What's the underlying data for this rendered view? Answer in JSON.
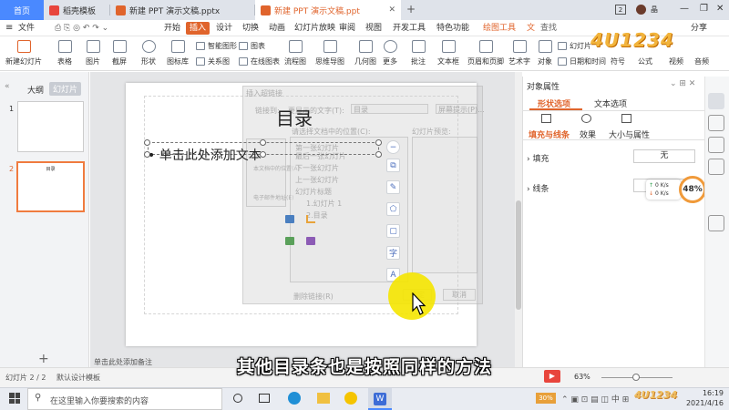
{
  "tabs": [
    {
      "label": "首页"
    },
    {
      "label": "稻壳模板"
    },
    {
      "label": "新建 PPT 演示文稿.pptx"
    },
    {
      "label": "新建 PPT 演示文稿.ppt"
    }
  ],
  "tabbar_right": {
    "badge": "2",
    "user": "晶"
  },
  "menu": {
    "file": "文件",
    "items": [
      "开始",
      "插入",
      "设计",
      "切换",
      "动画",
      "幻灯片放映",
      "审阅",
      "视图",
      "开发工具",
      "特色功能",
      "绘图工具",
      "文"
    ],
    "active": "插入",
    "search": "查找",
    "right": [
      "分享"
    ]
  },
  "ribbon": {
    "big": [
      "新建幻灯片",
      "表格",
      "图片",
      "截屏",
      "形状",
      "图标库",
      "关系图",
      "流程图",
      "思维导图",
      "几何图",
      "更多",
      "批注",
      "文本框",
      "页眉和页脚",
      "艺术字",
      "对象"
    ],
    "small": [
      "智能图形",
      "图表",
      "在线图表",
      "幻灯片",
      "日期和时间"
    ],
    "right_partial": [
      "符号",
      "公式",
      "视频",
      "音频"
    ]
  },
  "left_panel": {
    "tab_outline": "大纲",
    "tab_slides": "幻灯片",
    "slides": [
      {
        "num": "1"
      },
      {
        "num": "2",
        "title": "目录"
      }
    ],
    "add": "+"
  },
  "slide": {
    "title": "目录",
    "placeholder": "单击此处添加文本"
  },
  "ghost_dialog": {
    "title": "插入超链接",
    "link_to_label": "链接到:",
    "display_text_label": "要显示的文字(T):",
    "display_text_value": "目录",
    "tooltip": "屏幕提示(P)...",
    "select_position": "请选择文档中的位置(C):",
    "preview": "幻灯片预览:",
    "items": [
      "第一张幻灯片",
      "最后一张幻灯片",
      "下一张幻灯片",
      "上一张幻灯片",
      "幻灯片标题",
      "1.幻灯片 1",
      "2.目录"
    ],
    "left_items": [
      "原有文件或网页(X)",
      "本文档中的位置(A)",
      "电子邮件地址(E)",
      "链接附件"
    ],
    "remove_link": "删除链接(R)",
    "ok": "确定",
    "cancel": "取消"
  },
  "float_toolbar": [
    "−",
    "⧉",
    "✎",
    "⬠",
    "▢",
    "字",
    "A"
  ],
  "right_panel": {
    "header": "对象属性",
    "tab_shape": "形状选项",
    "tab_text": "文本选项",
    "sub_fill_line": "填充与线条",
    "sub_effect": "效果",
    "sub_size": "大小与属性",
    "fill_label": "填充",
    "fill_value": "无",
    "line_label": "线条",
    "line_value": "无",
    "speed_up": "0",
    "speed_down": "0",
    "speed_unit": "K/s",
    "percent": "48%"
  },
  "status": {
    "slide_info": "幻灯片 2 / 2",
    "template": "默认设计模板",
    "notes_placeholder": "单击此处添加备注",
    "zoom": "63%"
  },
  "taskbar": {
    "search_placeholder": "在这里输入你要搜索的内容",
    "battery": "30%",
    "time": "16:19",
    "date": "2021/4/16"
  },
  "watermark": "4U1234",
  "subtitle": "其他目录条也是按照同样的方法",
  "colors": {
    "home_tab": "#4a89ff",
    "accent_orange": "#e0642c",
    "selected_slide_border": "#f07b3f",
    "cursor_highlight": "#f5e500"
  }
}
